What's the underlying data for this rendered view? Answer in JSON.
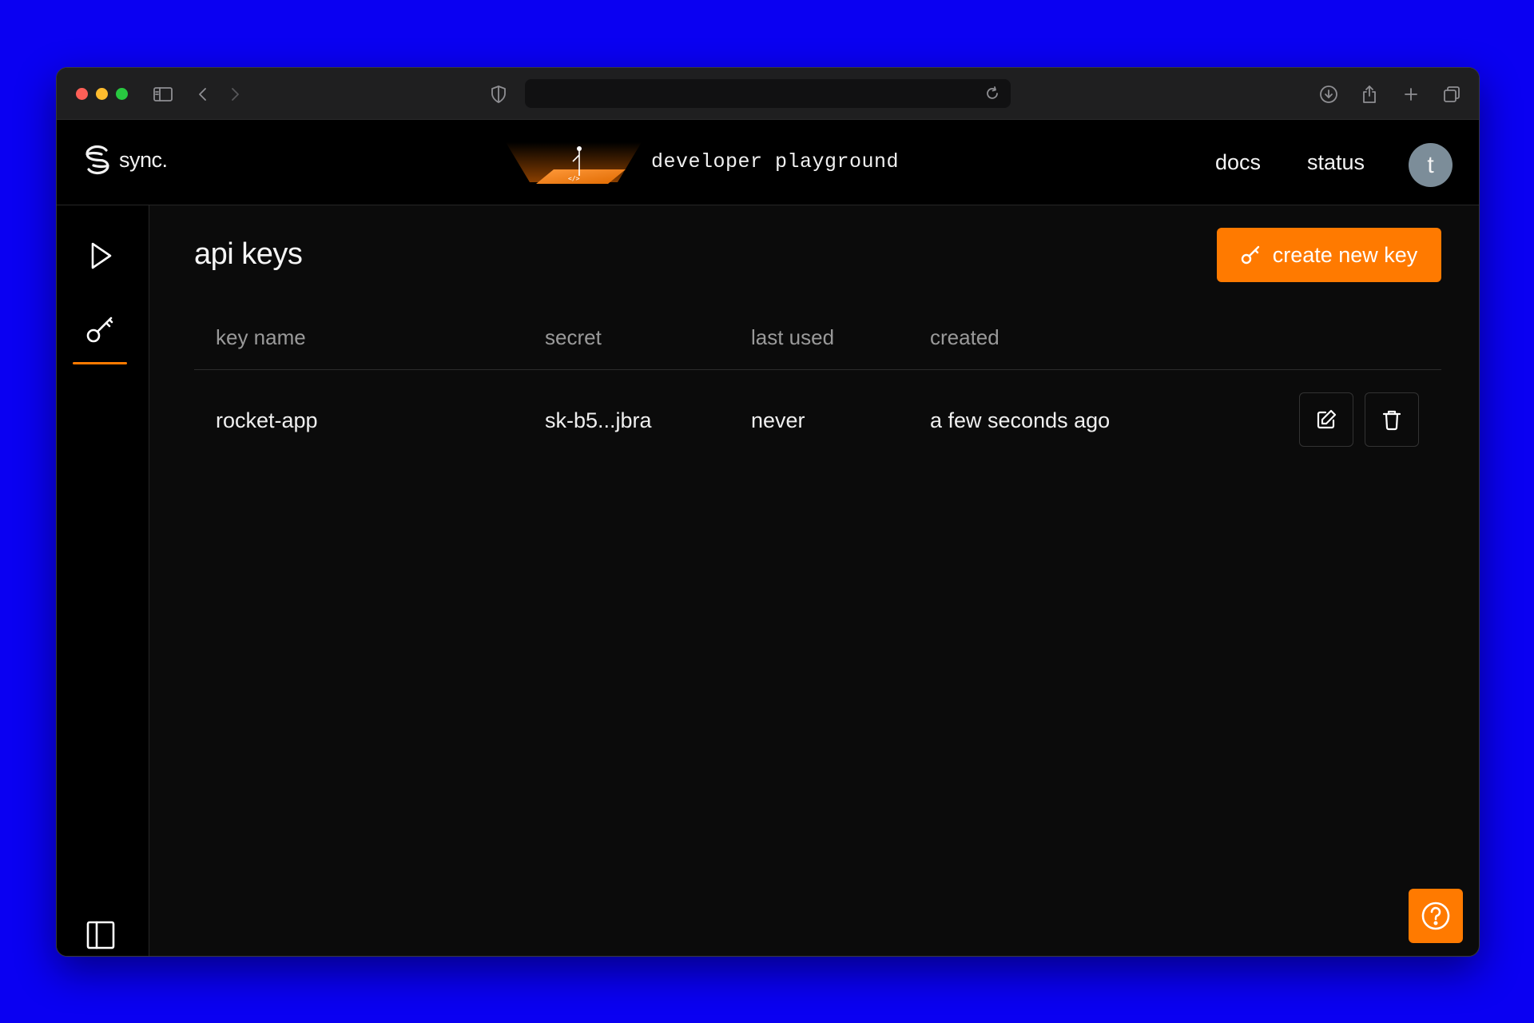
{
  "app": {
    "logo_text": "sync.",
    "banner_title": "developer playground",
    "nav": {
      "docs": "docs",
      "status": "status"
    },
    "avatar_initial": "t"
  },
  "page": {
    "title": "api keys",
    "create_button_label": "create new key"
  },
  "table": {
    "headers": [
      "key name",
      "secret",
      "last used",
      "created"
    ],
    "rows": [
      {
        "key_name": "rocket-app",
        "secret": "sk-b5...jbra",
        "last_used": "never",
        "created": "a few seconds ago"
      }
    ]
  },
  "colors": {
    "accent": "#ff7a00",
    "background": "#0a00f2",
    "app_bg": "#0b0b0b"
  },
  "icons": {
    "sidebar": [
      "play-icon",
      "key-icon",
      "sidebar-toggle-icon"
    ],
    "row_actions": [
      "edit-icon",
      "trash-icon"
    ],
    "help": "help-icon"
  }
}
